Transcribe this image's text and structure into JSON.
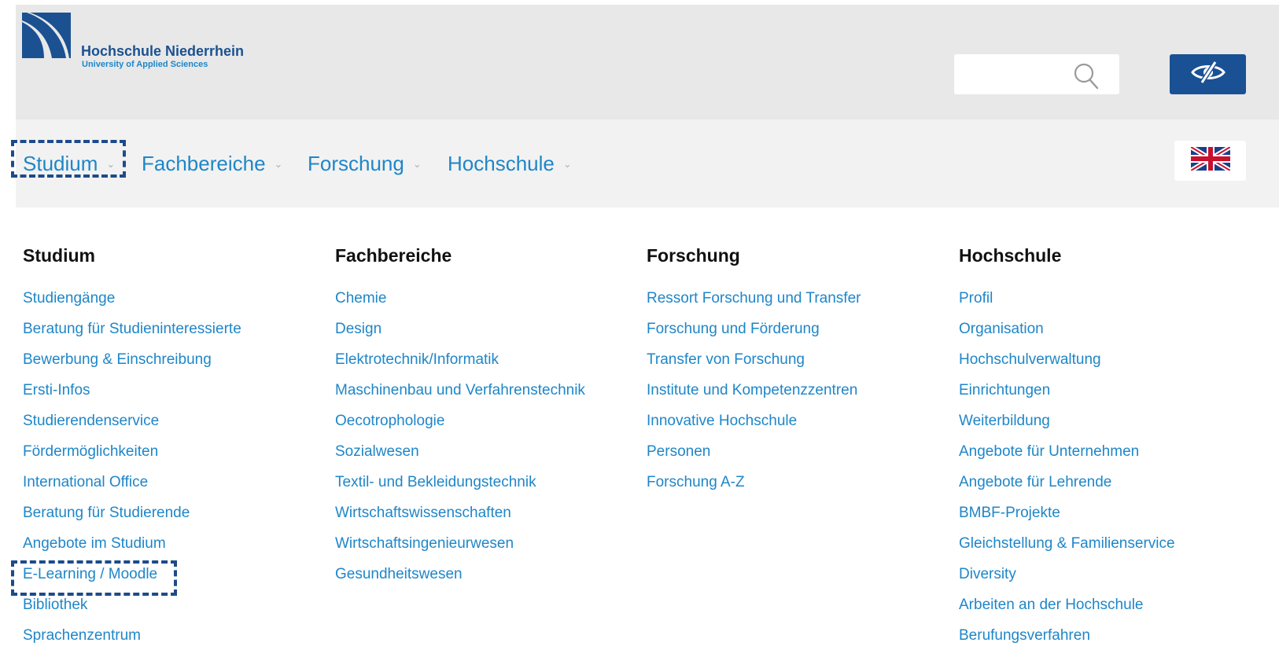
{
  "header": {
    "logo": {
      "name": "Hochschule Niederrhein",
      "subtitle": "University of Applied Sciences"
    },
    "search": {
      "value": "",
      "placeholder": ""
    },
    "colors": {
      "brand_dark": "#1b5191",
      "link": "#1e86c8",
      "header_bg": "#e8e8e8",
      "nav_bg": "#f2f2f2"
    }
  },
  "nav": {
    "items": [
      {
        "label": "Studium"
      },
      {
        "label": "Fachbereiche"
      },
      {
        "label": "Forschung"
      },
      {
        "label": "Hochschule"
      }
    ],
    "language_icon": "uk-flag-icon"
  },
  "menu": {
    "columns": [
      {
        "title": "Studium",
        "links": [
          "Studiengänge",
          "Beratung für Studieninteressierte",
          "Bewerbung & Einschreibung",
          "Ersti-Infos",
          "Studierendenservice",
          "Fördermöglichkeiten",
          "International Office",
          "Beratung für Studierende",
          "Angebote im Studium",
          "E-Learning / Moodle",
          "Bibliothek",
          "Sprachenzentrum"
        ]
      },
      {
        "title": "Fachbereiche",
        "links": [
          "Chemie",
          "Design",
          "Elektrotechnik/Informatik",
          "Maschinenbau und Verfahrenstechnik",
          "Oecotrophologie",
          "Sozialwesen",
          "Textil- und Bekleidungstechnik",
          "Wirtschaftswissenschaften",
          "Wirtschaftsingenieurwesen",
          "Gesundheitswesen"
        ]
      },
      {
        "title": "Forschung",
        "links": [
          "Ressort Forschung und Transfer",
          "Forschung und Förderung",
          "Transfer von Forschung",
          "Institute und Kompetenzzentren",
          "Innovative Hochschule",
          "Personen",
          "Forschung A-Z"
        ]
      },
      {
        "title": "Hochschule",
        "links": [
          "Profil",
          "Organisation",
          "Hochschulverwaltung",
          "Einrichtungen",
          "Weiterbildung",
          "Angebote für Unternehmen",
          "Angebote für Lehrende",
          "BMBF-Projekte",
          "Gleichstellung & Familienservice",
          "Diversity",
          "Arbeiten an der Hochschule",
          "Berufungsverfahren"
        ]
      }
    ]
  }
}
